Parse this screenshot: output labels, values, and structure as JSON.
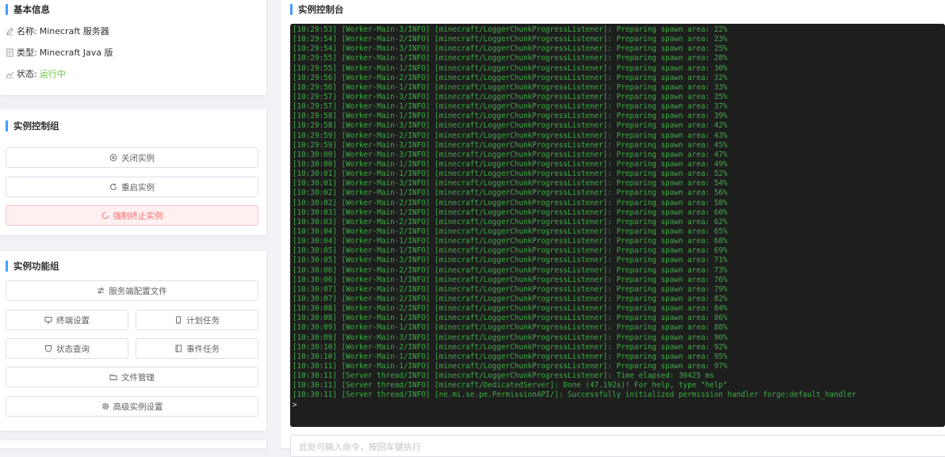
{
  "basic_info": {
    "title": "基本信息",
    "name_label": "名称:",
    "name_value": "Minecraft 服务器",
    "type_label": "类型:",
    "type_value": "Minecraft Java 版",
    "status_label": "状态:",
    "status_value": "运行中"
  },
  "control_group": {
    "title": "实例控制组",
    "close_label": "关闭实例",
    "restart_label": "重启实例",
    "kill_label": "强制终止实例"
  },
  "function_group": {
    "title": "实例功能组",
    "server_config_label": "服务端配置文件",
    "terminal_settings_label": "终端设置",
    "scheduled_tasks_label": "计划任务",
    "status_query_label": "状态查询",
    "event_tasks_label": "事件任务",
    "file_manager_label": "文件管理",
    "advanced_settings_label": "高级实例设置"
  },
  "console": {
    "title": "实例控制台",
    "prompt": ">",
    "input_placeholder": "此处可输入命令，按回车键执行",
    "lines": [
      "[10:29:53] [Worker-Main-3/INFO] [minecraft/LoggerChunkProgressListener]: Preparing spawn area: 22%",
      "[10:29:54] [Worker-Main-2/INFO] [minecraft/LoggerChunkProgressListener]: Preparing spawn area: 23%",
      "[10:29:54] [Worker-Main-3/INFO] [minecraft/LoggerChunkProgressListener]: Preparing spawn area: 25%",
      "[10:29:55] [Worker-Main-1/INFO] [minecraft/LoggerChunkProgressListener]: Preparing spawn area: 28%",
      "[10:29:55] [Worker-Main-1/INFO] [minecraft/LoggerChunkProgressListener]: Preparing spawn area: 30%",
      "[10:29:56] [Worker-Main-2/INFO] [minecraft/LoggerChunkProgressListener]: Preparing spawn area: 32%",
      "[10:29:56] [Worker-Main-1/INFO] [minecraft/LoggerChunkProgressListener]: Preparing spawn area: 33%",
      "[10:29:57] [Worker-Main-3/INFO] [minecraft/LoggerChunkProgressListener]: Preparing spawn area: 35%",
      "[10:29:57] [Worker-Main-1/INFO] [minecraft/LoggerChunkProgressListener]: Preparing spawn area: 37%",
      "[10:29:58] [Worker-Main-1/INFO] [minecraft/LoggerChunkProgressListener]: Preparing spawn area: 39%",
      "[10:29:58] [Worker-Main-3/INFO] [minecraft/LoggerChunkProgressListener]: Preparing spawn area: 42%",
      "[10:29:59] [Worker-Main-2/INFO] [minecraft/LoggerChunkProgressListener]: Preparing spawn area: 43%",
      "[10:29:59] [Worker-Main-3/INFO] [minecraft/LoggerChunkProgressListener]: Preparing spawn area: 45%",
      "[10:30:00] [Worker-Main-3/INFO] [minecraft/LoggerChunkProgressListener]: Preparing spawn area: 47%",
      "[10:30:00] [Worker-Main-1/INFO] [minecraft/LoggerChunkProgressListener]: Preparing spawn area: 49%",
      "[10:30:01] [Worker-Main-1/INFO] [minecraft/LoggerChunkProgressListener]: Preparing spawn area: 52%",
      "[10:30:01] [Worker-Main-3/INFO] [minecraft/LoggerChunkProgressListener]: Preparing spawn area: 54%",
      "[10:30:02] [Worker-Main-1/INFO] [minecraft/LoggerChunkProgressListener]: Preparing spawn area: 56%",
      "[10:30:02] [Worker-Main-2/INFO] [minecraft/LoggerChunkProgressListener]: Preparing spawn area: 58%",
      "[10:30:03] [Worker-Main-1/INFO] [minecraft/LoggerChunkProgressListener]: Preparing spawn area: 60%",
      "[10:30:03] [Worker-Main-2/INFO] [minecraft/LoggerChunkProgressListener]: Preparing spawn area: 62%",
      "[10:30:04] [Worker-Main-2/INFO] [minecraft/LoggerChunkProgressListener]: Preparing spawn area: 65%",
      "[10:30:04] [Worker-Main-1/INFO] [minecraft/LoggerChunkProgressListener]: Preparing spawn area: 68%",
      "[10:30:05] [Worker-Main-1/INFO] [minecraft/LoggerChunkProgressListener]: Preparing spawn area: 69%",
      "[10:30:05] [Worker-Main-3/INFO] [minecraft/LoggerChunkProgressListener]: Preparing spawn area: 71%",
      "[10:30:06] [Worker-Main-2/INFO] [minecraft/LoggerChunkProgressListener]: Preparing spawn area: 73%",
      "[10:30:06] [Worker-Main-1/INFO] [minecraft/LoggerChunkProgressListener]: Preparing spawn area: 76%",
      "[10:30:07] [Worker-Main-2/INFO] [minecraft/LoggerChunkProgressListener]: Preparing spawn area: 79%",
      "[10:30:07] [Worker-Main-2/INFO] [minecraft/LoggerChunkProgressListener]: Preparing spawn area: 82%",
      "[10:30:08] [Worker-Main-2/INFO] [minecraft/LoggerChunkProgressListener]: Preparing spawn area: 84%",
      "[10:30:08] [Worker-Main-1/INFO] [minecraft/LoggerChunkProgressListener]: Preparing spawn area: 86%",
      "[10:30:09] [Worker-Main-1/INFO] [minecraft/LoggerChunkProgressListener]: Preparing spawn area: 88%",
      "[10:30:09] [Worker-Main-3/INFO] [minecraft/LoggerChunkProgressListener]: Preparing spawn area: 90%",
      "[10:30:10] [Worker-Main-2/INFO] [minecraft/LoggerChunkProgressListener]: Preparing spawn area: 92%",
      "[10:30:10] [Worker-Main-1/INFO] [minecraft/LoggerChunkProgressListener]: Preparing spawn area: 95%",
      "[10:30:11] [Worker-Main-1/INFO] [minecraft/LoggerChunkProgressListener]: Preparing spawn area: 97%",
      "[10:30:11] [Server thread/INFO] [minecraft/LoggerChunkProgressListener]: Time elapsed: 30425 ms",
      "[10:30:11] [Server thread/INFO] [minecraft/DedicatedServer]: Done (47.192s)! For help, type \"help\"",
      "[10:30:11] [Server thread/INFO] [ne.mi.se.pe.PermissionAPI/]: Successfully initialized permission handler forge:default_handler"
    ]
  },
  "colors": {
    "accent": "#409eff",
    "running": "#67c23a",
    "danger": "#f56c6c",
    "console_bg": "#1e1e1e",
    "console_text": "#3cb043"
  },
  "icons": {
    "name": "edit-icon",
    "type": "document-icon",
    "status": "chart-icon",
    "close": "circle-close-icon",
    "restart": "refresh-icon",
    "kill": "loading-icon",
    "server_config": "sliders-icon",
    "terminal": "monitor-icon",
    "schedule": "phone-icon",
    "status_query": "shield-icon",
    "events": "notebook-icon",
    "files": "folder-icon",
    "advanced": "gear-icon"
  }
}
